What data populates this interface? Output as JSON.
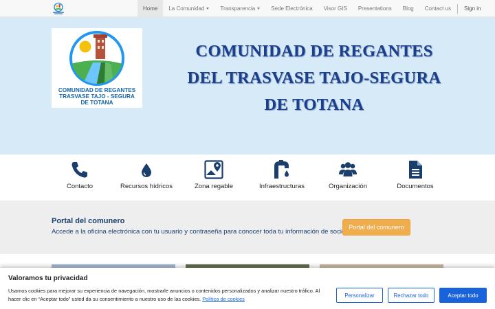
{
  "navbar": {
    "items": [
      {
        "label": "Home",
        "active": true,
        "dropdown": false
      },
      {
        "label": "La Comunidad",
        "active": false,
        "dropdown": true
      },
      {
        "label": "Transparencia",
        "active": false,
        "dropdown": true
      },
      {
        "label": "Sede Electrónica",
        "active": false,
        "dropdown": false
      },
      {
        "label": "Visor GIS",
        "active": false,
        "dropdown": false
      },
      {
        "label": "Presentations",
        "active": false,
        "dropdown": false
      },
      {
        "label": "Blog",
        "active": false,
        "dropdown": false
      },
      {
        "label": "Contact us",
        "active": false,
        "dropdown": false
      }
    ],
    "signin_label": "Sign in"
  },
  "hero": {
    "logo_lines": [
      "COMUNIDAD DE REGANTES",
      "TRASVASE TAJO - SEGURA",
      "DE TOTANA"
    ],
    "title_lines": [
      "COMUNIDAD DE REGANTES",
      "DEL TRASVASE TAJO-SEGURA",
      "DE TOTANA"
    ]
  },
  "quick_links": [
    {
      "label": "Contacto",
      "icon": "phone-icon"
    },
    {
      "label": "Recursos hídricos",
      "icon": "water-drop-icon"
    },
    {
      "label": "Zona regable",
      "icon": "map-marker-icon"
    },
    {
      "label": "Infraestructuras",
      "icon": "faucet-icon"
    },
    {
      "label": "Organización",
      "icon": "users-icon"
    },
    {
      "label": "Documentos",
      "icon": "document-icon"
    }
  ],
  "portal": {
    "title": "Portal del comunero",
    "description": "Accede a la oficina electrónica con tu usuario y contraseña para conocer toda tu información de socio",
    "button_label": "Portal del comunero"
  },
  "cookie": {
    "title": "Valoramos tu privacidad",
    "text": "Usamos cookies para mejorar su experiencia de navegación, mostrarle anuncios o contenidos personalizados y analizar nuestro tráfico. Al hacer clic en “Aceptar todo” usted da su consentimiento a nuestro uso de las cookies.",
    "policy_link": "Política de cookies",
    "customize_label": "Personalizar",
    "reject_label": "Rechazar todo",
    "accept_label": "Aceptar todo"
  },
  "colors": {
    "hero_bg": "#d6eaf8",
    "title_blue": "#1a3f8c",
    "icon_blue": "#1a3f6c",
    "portal_button": "#f0ad4e",
    "cookie_accent": "#1863dc"
  }
}
